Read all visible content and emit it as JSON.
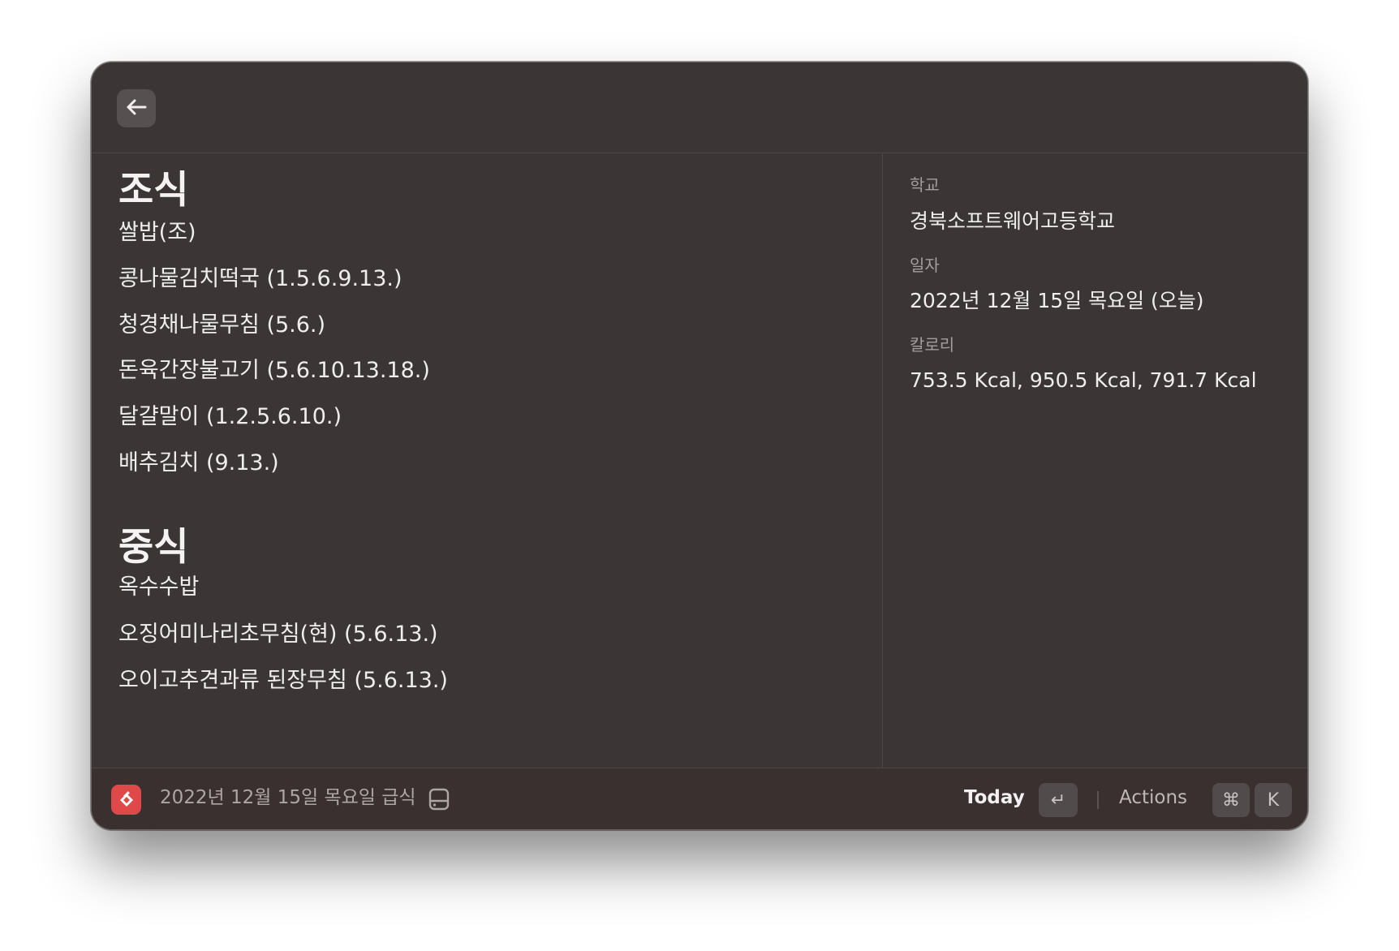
{
  "back_icon": "arrow-left-icon",
  "sections": [
    {
      "title": "조식",
      "items": [
        "쌀밥(조)",
        "콩나물김치떡국 (1.5.6.9.13.)",
        "청경채나물무침 (5.6.)",
        "돈육간장불고기 (5.6.10.13.18.)",
        "달걀말이 (1.2.5.6.10.)",
        "배추김치 (9.13.)"
      ]
    },
    {
      "title": "중식",
      "items": [
        "옥수수밥",
        "오징어미나리초무침(현) (5.6.13.)",
        "오이고추견과류 된장무침 (5.6.13.)"
      ]
    }
  ],
  "metadata": {
    "school_label": "학교",
    "school_value": "경북소프트웨어고등학교",
    "date_label": "일자",
    "date_value": "2022년 12월 15일 목요일 (오늘)",
    "calorie_label": "칼로리",
    "calorie_value": "753.5 Kcal, 950.5 Kcal, 791.7 Kcal"
  },
  "footer": {
    "app_icon": "school-meal-app-icon",
    "title": "2022년 12월 15일 목요일 급식",
    "status_icon": "hard-drive-icon",
    "primary_action": "Today",
    "primary_key": "↵",
    "actions_label": "Actions",
    "actions_keys": [
      "⌘",
      "K"
    ]
  },
  "colors": {
    "window_bg": "#3b3535",
    "footer_bg": "#3a302f",
    "app_icon_bg": "#e0494a",
    "text_primary": "#efeded",
    "text_secondary": "#a39d9d"
  }
}
